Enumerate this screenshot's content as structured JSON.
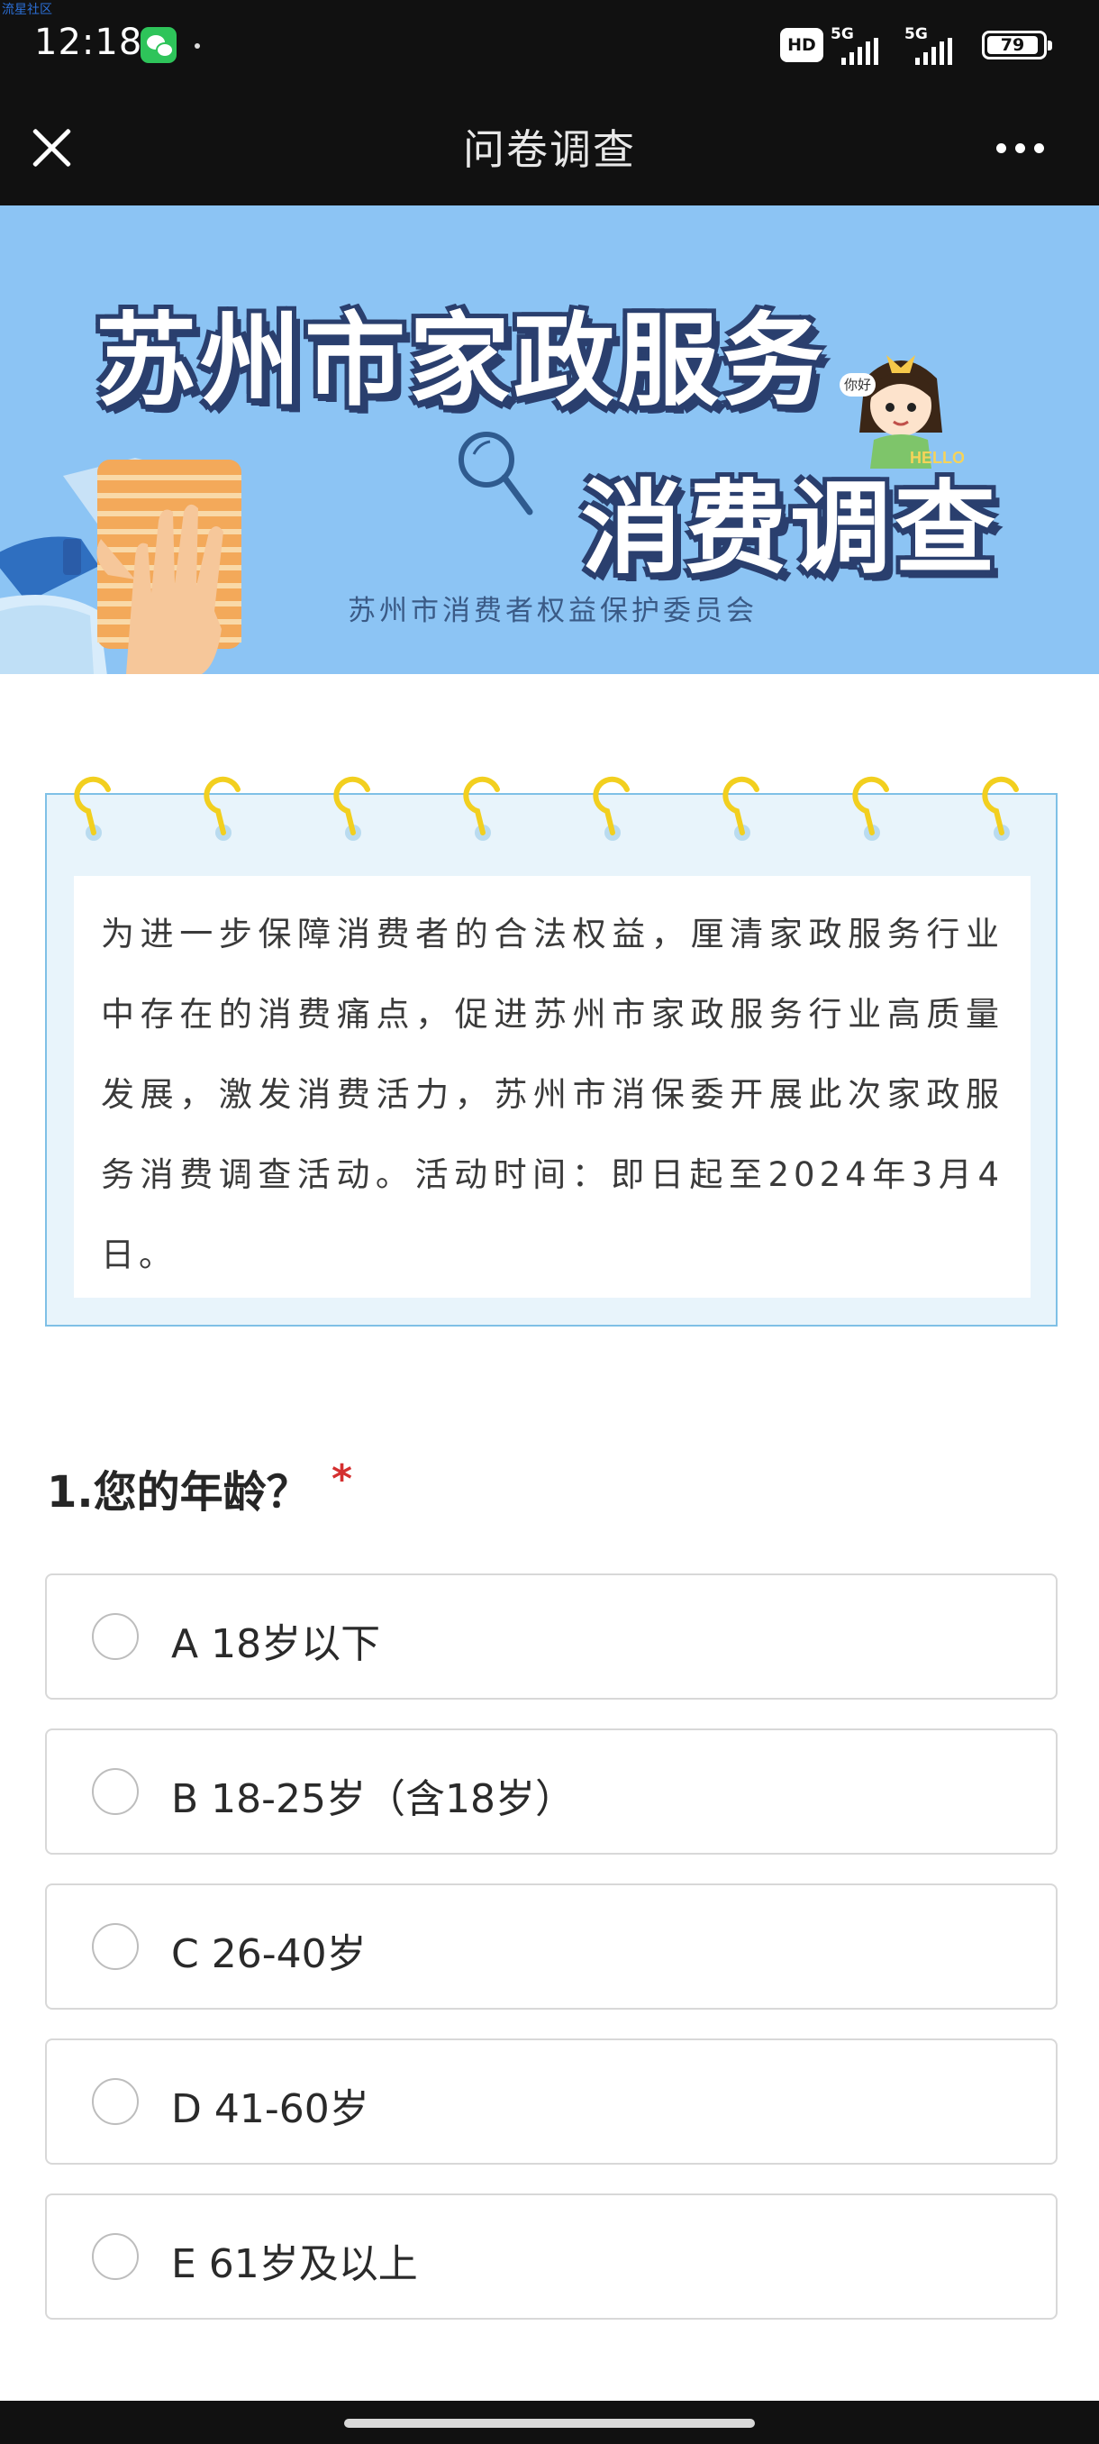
{
  "watermark": "流星社区",
  "status_bar": {
    "time": "12:18",
    "hd_badge": "HD",
    "network_1": "5G",
    "network_2": "5G",
    "battery": "79"
  },
  "nav": {
    "title": "问卷调查"
  },
  "banner": {
    "title_line1": "苏州市家政服务",
    "title_line2": "消费调查",
    "organization": "苏州市消费者权益保护委员会",
    "mascot_greeting": "你好"
  },
  "intro": {
    "text": "为进一步保障消费者的合法权益，厘清家政服务行业中存在的消费痛点，促进苏州市家政服务行业高质量发展，激发消费活力，苏州市消保委开展此次家政服务消费调查活动。活动时间：即日起至2024年3月4日。"
  },
  "question": {
    "title": "1.您的年龄？",
    "required_mark": "*",
    "options": [
      {
        "label": "A 18岁以下",
        "selected": false
      },
      {
        "label": "B 18-25岁（含18岁）",
        "selected": false
      },
      {
        "label": "C 26-40岁",
        "selected": false
      },
      {
        "label": "D 41-60岁",
        "selected": false
      },
      {
        "label": "E 61岁及以上",
        "selected": false
      }
    ]
  },
  "colors": {
    "banner_bg": "#8cc4f4",
    "notebook_border": "#7fc0e6",
    "required": "#d42f2f",
    "chrome_bg": "#111111"
  }
}
